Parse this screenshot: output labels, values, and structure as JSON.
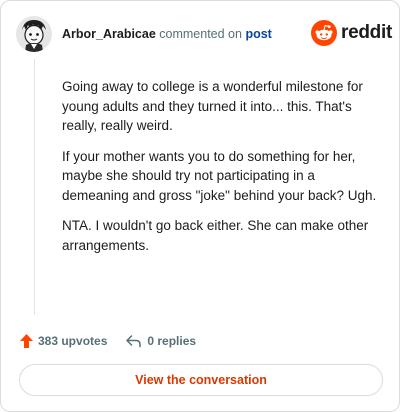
{
  "comment": {
    "author": "Arbor_Arabicae",
    "action_text": "commented on",
    "target_link": "post",
    "paragraphs": [
      "Going away to college is a wonderful milestone for young adults and they turned it into... this. That's really, really weird.",
      "If your mother wants you to do something for her, maybe she should try not participating in a demeaning and gross \"joke\" behind your back? Ugh.",
      "NTA. I wouldn't go back either. She can make other arrangements."
    ]
  },
  "brand": {
    "name": "reddit",
    "color": "#ff4500",
    "icon": "reddit-snoo-icon"
  },
  "actions": {
    "upvotes_label": "383 upvotes",
    "replies_label": "0 replies",
    "upvote_icon": "upvote-arrow-icon",
    "reply_icon": "reply-arrow-icon",
    "upvote_color": "#ff4500"
  },
  "cta": {
    "label": "View the conversation",
    "color": "#d93900"
  }
}
